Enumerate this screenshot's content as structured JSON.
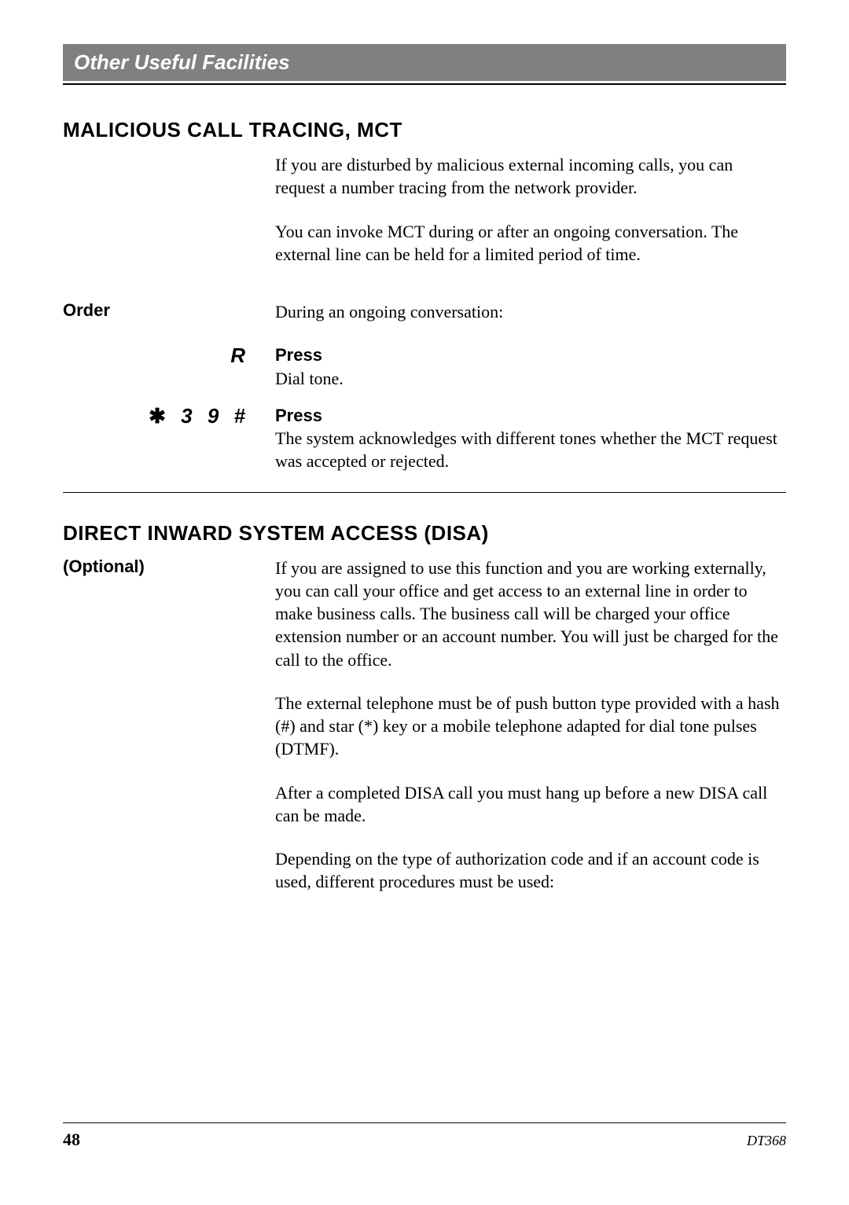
{
  "header": {
    "bar_title": "Other Useful Facilities"
  },
  "mct": {
    "title": "MALICIOUS CALL TRACING, MCT",
    "intro1": "If you are disturbed by malicious external incoming calls, you can request a number tracing from the network provider.",
    "intro2": "You can invoke MCT during or after an ongoing conversation. The external line can be held for a limited period of time.",
    "order_label": "Order",
    "order_text": "During an ongoing conversation:",
    "step1_key": "R",
    "step1_action": "Press",
    "step1_desc": "Dial tone.",
    "step2_key_star": "✱",
    "step2_key_rest": " 3 9 #",
    "step2_action": "Press",
    "step2_desc": "The system acknowledges with different tones whether the MCT request was accepted or rejected."
  },
  "disa": {
    "title": "DIRECT INWARD SYSTEM ACCESS (DISA)",
    "optional_label": "(Optional)",
    "para1": "If you are assigned to use this function and you are working externally, you can call your office and get access to an external line in order to make business calls. The business call will be charged your office extension number or an account number. You will just be charged for the call to the office.",
    "para2": "The external telephone must be of push button type provided with a hash (#) and star (*) key or a mobile telephone adapted for dial tone pulses (DTMF).",
    "para3": "After a completed DISA call you must hang up before a new DISA call can be made.",
    "para4": "Depending on the type of authorization code and if an account code is used, different procedures must be used:"
  },
  "footer": {
    "page_number": "48",
    "doc_id": "DT368"
  }
}
